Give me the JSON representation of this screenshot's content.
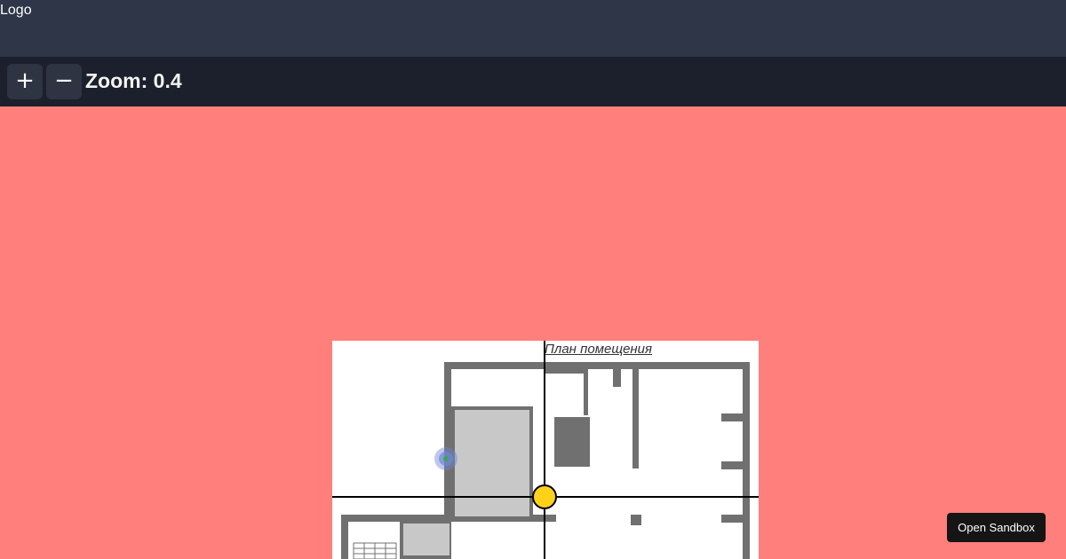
{
  "header": {
    "logo": "Logo"
  },
  "toolbar": {
    "zoom_in_label": "+",
    "zoom_out_label": "−",
    "zoom_label": "Zoom: 0.4"
  },
  "floor_plan": {
    "title": "План помещения"
  },
  "sandbox": {
    "label": "Open Sandbox"
  },
  "colors": {
    "canvas_background": "#ff7f7c",
    "header_background": "#2e3648",
    "toolbar_background": "#1b202c",
    "center_marker": "#ffd21a",
    "location_marker": "#6f86d6"
  }
}
